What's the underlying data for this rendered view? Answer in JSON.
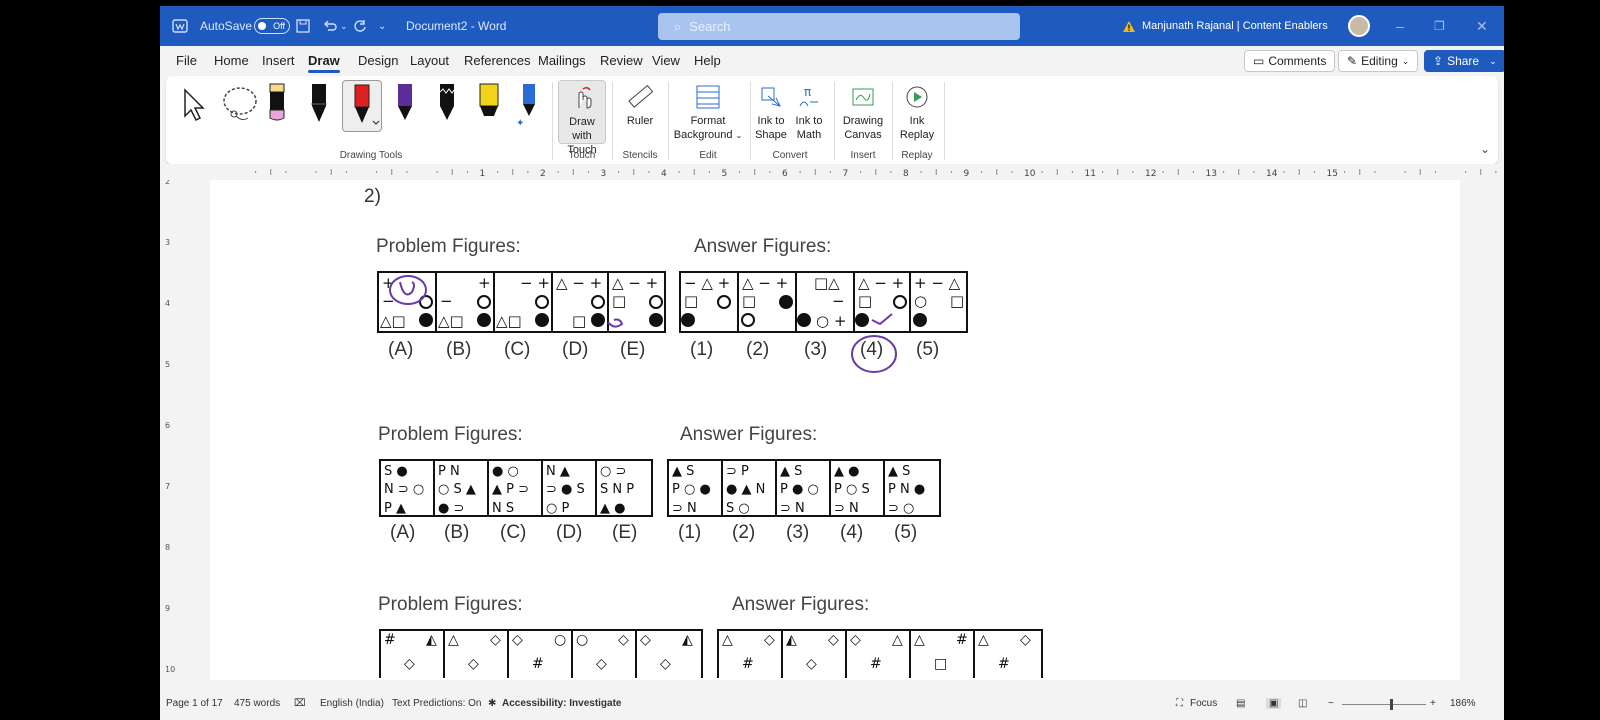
{
  "titlebar": {
    "autosave_label": "AutoSave",
    "autosave_state": "Off",
    "document_title": "Document2  -  Word",
    "search_placeholder": "Search",
    "user_name": "Manjunath Rajanal | Content Enablers"
  },
  "tabs": [
    "File",
    "Home",
    "Insert",
    "Draw",
    "Design",
    "Layout",
    "References",
    "Mailings",
    "Review",
    "View",
    "Help"
  ],
  "active_tab": "Draw",
  "ribbon_buttons": {
    "comments": "Comments",
    "editing": "Editing",
    "share": "Share"
  },
  "ribbon": {
    "drawing_tools_label": "Drawing Tools",
    "touch": {
      "line1": "Draw with",
      "line2": "Touch",
      "group": "Touch"
    },
    "ruler": {
      "label": "Ruler",
      "group": "Stencils"
    },
    "format_bg": {
      "line1": "Format",
      "line2": "Background",
      "group": "Edit"
    },
    "ink_shape": {
      "line1": "Ink to",
      "line2": "Shape"
    },
    "ink_math": {
      "line1": "Ink to",
      "line2": "Math"
    },
    "convert_group": "Convert",
    "drawing_canvas": {
      "line1": "Drawing",
      "line2": "Canvas",
      "group": "Insert"
    },
    "ink_replay": {
      "line1": "Ink",
      "line2": "Replay",
      "group": "Replay"
    },
    "pen_colors": [
      "#e9a6d8",
      "#111111",
      "#e02020",
      "#5b2d9a",
      "#111111",
      "#f3d21a",
      "#2a6bd6"
    ]
  },
  "ruler_numbers": [
    "1",
    "2",
    "3",
    "4",
    "5",
    "6",
    "7",
    "8",
    "9",
    "10",
    "11",
    "12",
    "13",
    "14",
    "15"
  ],
  "vruler_numbers": [
    "2",
    "3",
    "4",
    "5",
    "6",
    "7",
    "8",
    "9",
    "10"
  ],
  "document": {
    "question_number": "2)",
    "sets": [
      {
        "problem_heading": "Problem Figures:",
        "answer_heading": "Answer Figures:",
        "problem_labels": [
          "(A)",
          "(B)",
          "(C)",
          "(D)",
          "(E)"
        ],
        "answer_labels": [
          "(1)",
          "(2)",
          "(3)",
          "(4)",
          "(5)"
        ]
      },
      {
        "problem_heading": "Problem Figures:",
        "answer_heading": "Answer Figures:",
        "problem_labels": [
          "(A)",
          "(B)",
          "(C)",
          "(D)",
          "(E)"
        ],
        "answer_labels": [
          "(1)",
          "(2)",
          "(3)",
          "(4)",
          "(5)"
        ]
      },
      {
        "problem_heading": "Problem Figures:",
        "answer_heading": "Answer Figures:"
      }
    ]
  },
  "statusbar": {
    "page": "Page 1 of 17",
    "words": "475 words",
    "language": "English (India)",
    "text_predictions": "Text Predictions: On",
    "accessibility": "Accessibility: Investigate",
    "focus": "Focus",
    "zoom": "186%"
  }
}
